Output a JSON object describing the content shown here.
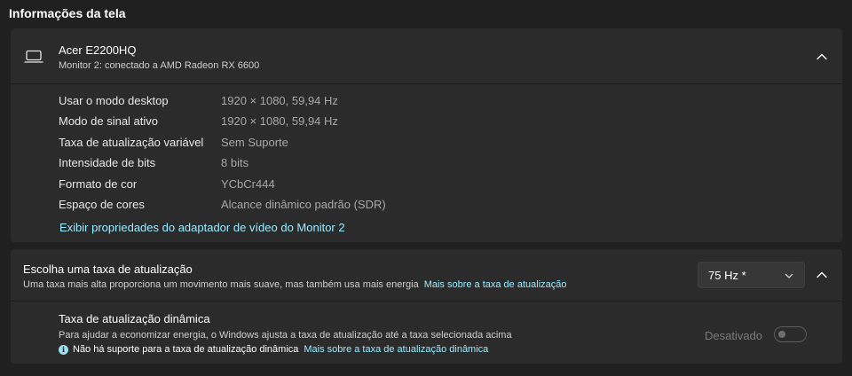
{
  "section": {
    "title": "Informações da tela"
  },
  "display": {
    "icon": "laptop-monitor-icon",
    "name": "Acer E2200HQ",
    "subtitle": "Monitor 2: conectado a AMD Radeon RX 6600",
    "rows": [
      {
        "label": "Usar o modo desktop",
        "value": "1920 × 1080, 59,94 Hz"
      },
      {
        "label": "Modo de sinal ativo",
        "value": "1920 × 1080, 59,94 Hz"
      },
      {
        "label": "Taxa de atualização variável",
        "value": "Sem Suporte"
      },
      {
        "label": "Intensidade de bits",
        "value": "8 bits"
      },
      {
        "label": "Formato de cor",
        "value": "YCbCr444"
      },
      {
        "label": "Espaço de cores",
        "value": "Alcance dinâmico padrão (SDR)"
      }
    ],
    "adapter_link": "Exibir propriedades do adaptador de vídeo do Monitor 2"
  },
  "refresh": {
    "title": "Escolha uma taxa de atualização",
    "description": "Uma taxa mais alta proporciona um movimento mais suave, mas também usa mais energia",
    "more_link": "Mais sobre a taxa de atualização",
    "selected": "75 Hz *",
    "dynamic": {
      "title": "Taxa de atualização dinâmica",
      "description": "Para ajudar a economizar energia, o Windows ajusta a taxa de atualização até a taxa selecionada acima",
      "note": "Não há suporte para a taxa de atualização dinâmica",
      "note_link": "Mais sobre a taxa de atualização dinâmica",
      "toggle_label": "Desativado",
      "toggle_on": false
    }
  },
  "colors": {
    "background": "#202020",
    "card": "#2b2b2b",
    "link": "#99ebff",
    "secondary_text": "#a8a8a8"
  }
}
